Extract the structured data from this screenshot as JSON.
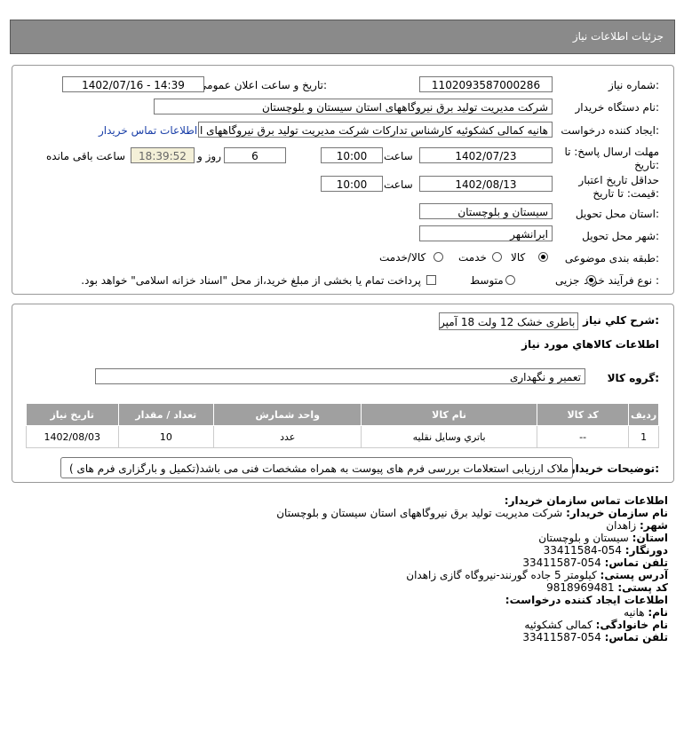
{
  "header": {
    "title": "جزئیات اطلاعات نیاز"
  },
  "form": {
    "need_number_label": "شماره نیاز:",
    "need_number": "1102093587000286",
    "announce_label": "تاریخ و ساعت اعلان عمومی:",
    "announce_value": "1402/07/16 - 14:39",
    "buyer_org_label": "نام دستگاه خریدار:",
    "buyer_org": "شرکت مدیریت تولید برق نیروگاههای استان سیستان و بلوچستان",
    "creator_label": "ایجاد کننده درخواست:",
    "creator": "هانیه کمالی کشکوئیه کارشناس تدارکات شرکت مدیریت تولید برق نیروگاههای ا",
    "contact_link": "اطلاعات تماس خریدار",
    "deadline_label_1": "مهلت ارسال پاسخ: تا",
    "deadline_label_2": "تاریخ:",
    "deadline_date": "1402/07/23",
    "time_label": "ساعت",
    "deadline_time": "10:00",
    "days_value": "6",
    "days_label": "روز و",
    "remaining_time": "18:39:52",
    "remaining_label": "ساعت باقی مانده",
    "validity_label_1": "حداقل تاریخ اعتبار",
    "validity_label_2": "قیمت: تا تاریخ:",
    "validity_date": "1402/08/13",
    "validity_time": "10:00",
    "province_label": "استان محل تحویل:",
    "province": "سیستان و بلوچستان",
    "city_label": "شهر محل تحویل:",
    "city": "ایرانشهر",
    "category_label": "طبقه بندی موضوعی:",
    "category_options": [
      "کالا",
      "خدمت",
      "کالا/خدمت"
    ],
    "process_label": "نوع فرآیند خرید :",
    "process_options": [
      "جزیی",
      "متوسط"
    ],
    "payment_note": "پرداخت تمام یا بخشی از مبلغ خرید،از محل \"اسناد خزانه اسلامی\" خواهد بود."
  },
  "need": {
    "summary_label": "شرح کلي نياز:",
    "summary": "باطری خشک 12 ولت 18 آمپر",
    "goods_info_title": "اطلاعات کالاهاي مورد نياز",
    "group_label": "گروه کالا:",
    "group_value": "تعمیر و نگهداری",
    "columns": [
      "ردیف",
      "کد کالا",
      "نام کالا",
      "واحد شمارش",
      "تعداد / مقدار",
      "تاریخ نیاز"
    ],
    "rows": [
      [
        "1",
        "--",
        "باتري وسايل نقليه",
        "عدد",
        "10",
        "1402/08/03"
      ]
    ],
    "buyer_notes_label": "توضیحات خریدار:",
    "buyer_notes": "ملاک ارزیابی استعلامات بررسی فرم های پیوست به همراه مشخصات فنی می باشد(تکمیل و بارگزاری فرم های )"
  },
  "contact": {
    "title": "اطلاعات تماس سازمان خریدار:",
    "org_label": "نام سازمان خریدار:",
    "org_value": "شرکت مدیریت تولید برق نیروگاههای استان سیستان و بلوچستان",
    "city_label": "شهر:",
    "city_value": "زاهدان",
    "province_label": "استان:",
    "province_value": "سیستان و بلوچستان",
    "fax_label": "دورنگار:",
    "fax_value": "054-33411584",
    "phone_label": "تلفن تماس:",
    "phone_value": "054-33411587",
    "address_label": "آدرس پستی:",
    "address_value": "کیلومتر 5 جاده گورنند-نیروگاه گازی زاهدان",
    "postal_label": "کد پستی:",
    "postal_value": "9818969481",
    "creator_title": "اطلاعات ایجاد کننده درخواست:",
    "name_label": "نام:",
    "name_value": "هانیه",
    "family_label": "نام خانوادگی:",
    "family_value": "کمالی کشکوئیه",
    "creator_phone_label": "تلفن تماس:",
    "creator_phone_value": "054-33411587"
  }
}
